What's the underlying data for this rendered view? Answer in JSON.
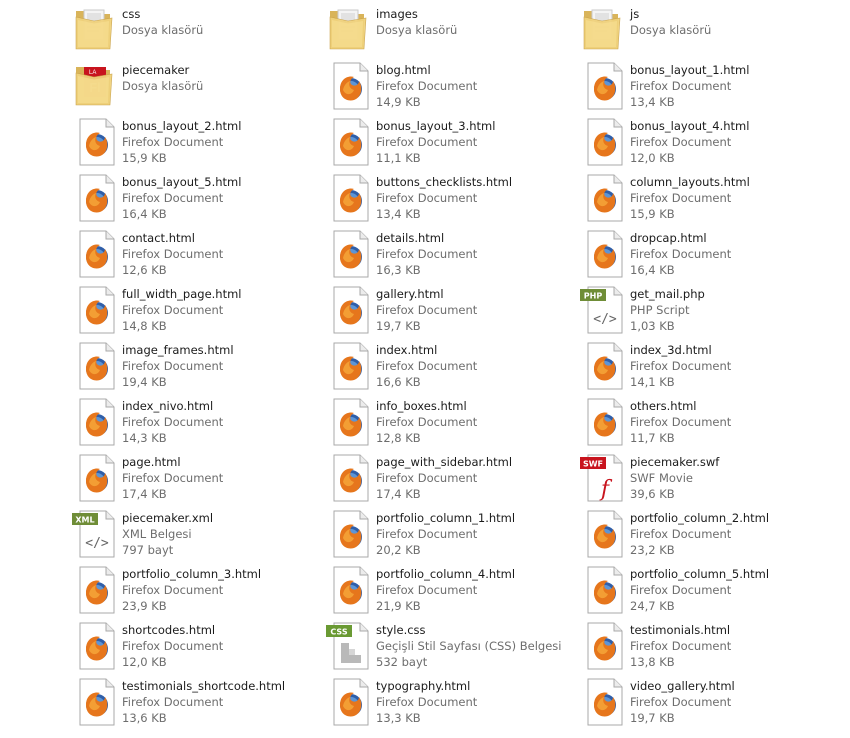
{
  "files": [
    {
      "name": "css",
      "type": "Dosya klasörü",
      "size": "",
      "icon": "folder-icon"
    },
    {
      "name": "images",
      "type": "Dosya klasörü",
      "size": "",
      "icon": "folder-icon"
    },
    {
      "name": "js",
      "type": "Dosya klasörü",
      "size": "",
      "icon": "folder-icon"
    },
    {
      "name": "piecemaker",
      "type": "Dosya klasörü",
      "size": "",
      "icon": "flash-folder-icon"
    },
    {
      "name": "blog.html",
      "type": "Firefox Document",
      "size": "14,9 KB",
      "icon": "firefox-document-icon"
    },
    {
      "name": "bonus_layout_1.html",
      "type": "Firefox Document",
      "size": "13,4 KB",
      "icon": "firefox-document-icon"
    },
    {
      "name": "bonus_layout_2.html",
      "type": "Firefox Document",
      "size": "15,9 KB",
      "icon": "firefox-document-icon"
    },
    {
      "name": "bonus_layout_3.html",
      "type": "Firefox Document",
      "size": "11,1 KB",
      "icon": "firefox-document-icon"
    },
    {
      "name": "bonus_layout_4.html",
      "type": "Firefox Document",
      "size": "12,0 KB",
      "icon": "firefox-document-icon"
    },
    {
      "name": "bonus_layout_5.html",
      "type": "Firefox Document",
      "size": "16,4 KB",
      "icon": "firefox-document-icon"
    },
    {
      "name": "buttons_checklists.html",
      "type": "Firefox Document",
      "size": "13,4 KB",
      "icon": "firefox-document-icon"
    },
    {
      "name": "column_layouts.html",
      "type": "Firefox Document",
      "size": "15,9 KB",
      "icon": "firefox-document-icon"
    },
    {
      "name": "contact.html",
      "type": "Firefox Document",
      "size": "12,6 KB",
      "icon": "firefox-document-icon"
    },
    {
      "name": "details.html",
      "type": "Firefox Document",
      "size": "16,3 KB",
      "icon": "firefox-document-icon"
    },
    {
      "name": "dropcap.html",
      "type": "Firefox Document",
      "size": "16,4 KB",
      "icon": "firefox-document-icon"
    },
    {
      "name": "full_width_page.html",
      "type": "Firefox Document",
      "size": "14,8 KB",
      "icon": "firefox-document-icon"
    },
    {
      "name": "gallery.html",
      "type": "Firefox Document",
      "size": "19,7 KB",
      "icon": "firefox-document-icon"
    },
    {
      "name": "get_mail.php",
      "type": "PHP Script",
      "size": "1,03 KB",
      "icon": "php-file-icon",
      "badge": "PHP"
    },
    {
      "name": "image_frames.html",
      "type": "Firefox Document",
      "size": "19,4 KB",
      "icon": "firefox-document-icon"
    },
    {
      "name": "index.html",
      "type": "Firefox Document",
      "size": "16,6 KB",
      "icon": "firefox-document-icon"
    },
    {
      "name": "index_3d.html",
      "type": "Firefox Document",
      "size": "14,1 KB",
      "icon": "firefox-document-icon"
    },
    {
      "name": "index_nivo.html",
      "type": "Firefox Document",
      "size": "14,3 KB",
      "icon": "firefox-document-icon"
    },
    {
      "name": "info_boxes.html",
      "type": "Firefox Document",
      "size": "12,8 KB",
      "icon": "firefox-document-icon"
    },
    {
      "name": "others.html",
      "type": "Firefox Document",
      "size": "11,7 KB",
      "icon": "firefox-document-icon"
    },
    {
      "name": "page.html",
      "type": "Firefox Document",
      "size": "17,4 KB",
      "icon": "firefox-document-icon"
    },
    {
      "name": "page_with_sidebar.html",
      "type": "Firefox Document",
      "size": "17,4 KB",
      "icon": "firefox-document-icon"
    },
    {
      "name": "piecemaker.swf",
      "type": "SWF Movie",
      "size": "39,6 KB",
      "icon": "swf-file-icon",
      "badge": "SWF"
    },
    {
      "name": "piecemaker.xml",
      "type": "XML Belgesi",
      "size": "797 bayt",
      "icon": "xml-file-icon",
      "badge": "XML"
    },
    {
      "name": "portfolio_column_1.html",
      "type": "Firefox Document",
      "size": "20,2 KB",
      "icon": "firefox-document-icon"
    },
    {
      "name": "portfolio_column_2.html",
      "type": "Firefox Document",
      "size": "23,2 KB",
      "icon": "firefox-document-icon"
    },
    {
      "name": "portfolio_column_3.html",
      "type": "Firefox Document",
      "size": "23,9 KB",
      "icon": "firefox-document-icon"
    },
    {
      "name": "portfolio_column_4.html",
      "type": "Firefox Document",
      "size": "21,9 KB",
      "icon": "firefox-document-icon"
    },
    {
      "name": "portfolio_column_5.html",
      "type": "Firefox Document",
      "size": "24,7 KB",
      "icon": "firefox-document-icon"
    },
    {
      "name": "shortcodes.html",
      "type": "Firefox Document",
      "size": "12,0 KB",
      "icon": "firefox-document-icon"
    },
    {
      "name": "style.css",
      "type": "Geçişli Stil Sayfası (CSS) Belgesi",
      "size": "532 bayt",
      "icon": "css-file-icon",
      "badge": "CSS"
    },
    {
      "name": "testimonials.html",
      "type": "Firefox Document",
      "size": "13,8 KB",
      "icon": "firefox-document-icon"
    },
    {
      "name": "testimonials_shortcode.html",
      "type": "Firefox Document",
      "size": "13,6 KB",
      "icon": "firefox-document-icon"
    },
    {
      "name": "typography.html",
      "type": "Firefox Document",
      "size": "13,3 KB",
      "icon": "firefox-document-icon"
    },
    {
      "name": "video_gallery.html",
      "type": "Firefox Document",
      "size": "19,7 KB",
      "icon": "firefox-document-icon"
    }
  ]
}
